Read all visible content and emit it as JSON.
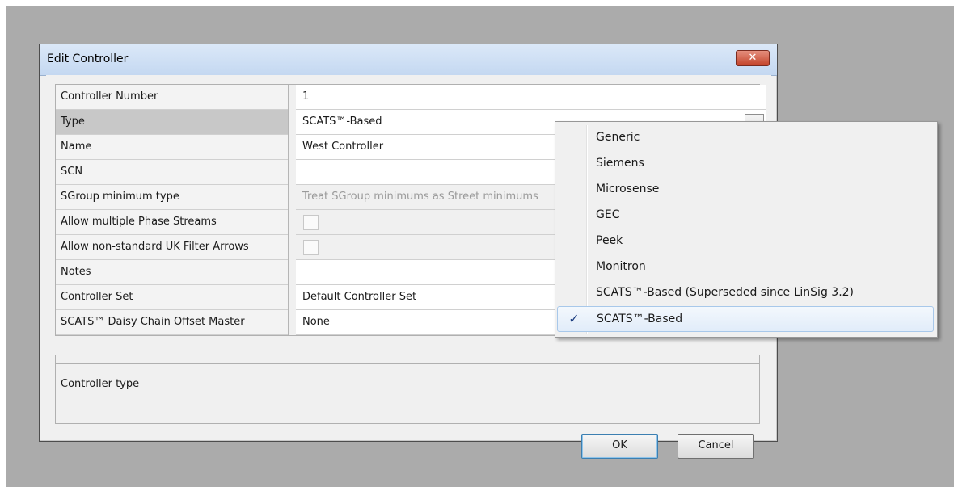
{
  "window": {
    "title": "Edit Controller",
    "close_glyph": "✕"
  },
  "grid": {
    "rows": [
      {
        "label": "Controller Number",
        "value": "1",
        "kind": "text"
      },
      {
        "label": "Type",
        "value": "SCATS™-Based",
        "kind": "dropdown",
        "selected": true
      },
      {
        "label": "Name",
        "value": "West Controller",
        "kind": "text"
      },
      {
        "label": "SCN",
        "value": "",
        "kind": "text"
      },
      {
        "label": "SGroup minimum type",
        "value": "Treat SGroup minimums as Street minimums",
        "kind": "disabled"
      },
      {
        "label": "Allow multiple Phase Streams",
        "value": "",
        "kind": "checkbox"
      },
      {
        "label": "Allow non-standard UK Filter Arrows",
        "value": "",
        "kind": "checkbox"
      },
      {
        "label": "Notes",
        "value": "",
        "kind": "text"
      },
      {
        "label": "Controller Set",
        "value": "Default Controller Set",
        "kind": "text"
      },
      {
        "label": "SCATS™ Daisy Chain Offset Master",
        "value": "None",
        "kind": "text"
      }
    ]
  },
  "description": {
    "text": "Controller type"
  },
  "buttons": {
    "ok": "OK",
    "cancel": "Cancel"
  },
  "type_menu": {
    "check_glyph": "✓",
    "items": [
      {
        "label": "Generic",
        "checked": false
      },
      {
        "label": "Siemens",
        "checked": false
      },
      {
        "label": "Microsense",
        "checked": false
      },
      {
        "label": "GEC",
        "checked": false
      },
      {
        "label": "Peek",
        "checked": false
      },
      {
        "label": "Monitron",
        "checked": false
      },
      {
        "label": "SCATS™-Based (Superseded since LinSig 3.2)",
        "checked": false
      },
      {
        "label": "SCATS™-Based",
        "checked": true
      }
    ]
  }
}
